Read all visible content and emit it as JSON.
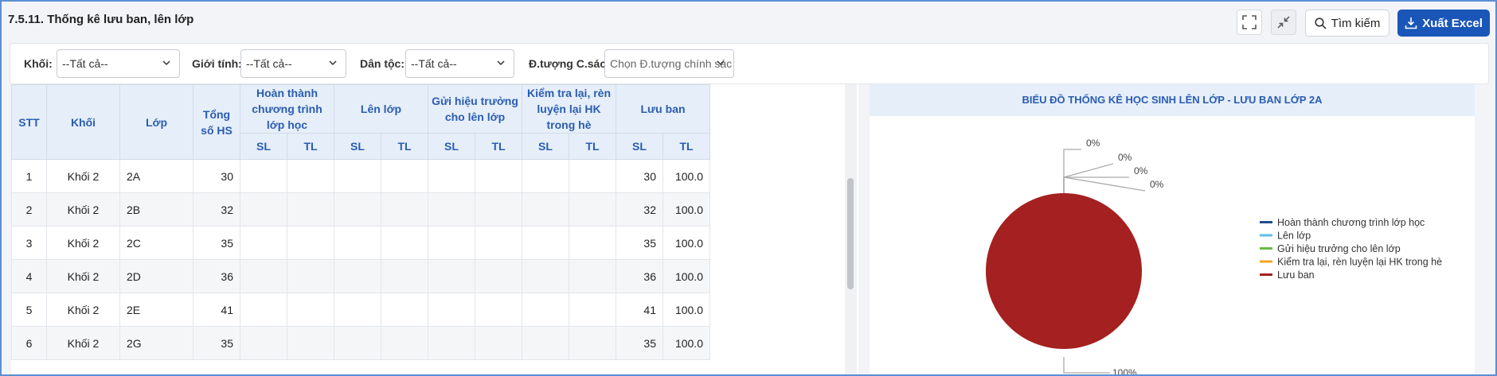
{
  "header": {
    "title": "7.5.11. Thống kê lưu ban, lên lớp",
    "search_label": "Tìm kiếm",
    "excel_label": "Xuất Excel"
  },
  "filters": {
    "khoi_label": "Khối:",
    "khoi_value": "--Tất cả--",
    "gioitinh_label": "Giới tính:",
    "gioitinh_value": "--Tất cả--",
    "dantoc_label": "Dân tộc:",
    "dantoc_value": "--Tất cả--",
    "doituong_label": "Đ.tượng C.sách:",
    "doituong_placeholder": "Chọn Đ.tượng chính sác"
  },
  "table": {
    "headers": {
      "stt": "STT",
      "khoi": "Khối",
      "lop": "Lớp",
      "tongso": "Tổng số HS",
      "hoanthanh": "Hoàn thành chương trình lớp học",
      "lenlop": "Lên lớp",
      "guihieutruong": "Gửi hiệu trưởng cho lên lớp",
      "kiemtra": "Kiểm tra lại, rèn luyện lại HK trong hè",
      "luuban": "Lưu ban",
      "sl": "SL",
      "tl": "TL"
    },
    "rows": [
      {
        "stt": "1",
        "khoi": "Khối 2",
        "lop": "2A",
        "tong": "30",
        "lb_sl": "30",
        "lb_tl": "100.0"
      },
      {
        "stt": "2",
        "khoi": "Khối 2",
        "lop": "2B",
        "tong": "32",
        "lb_sl": "32",
        "lb_tl": "100.0"
      },
      {
        "stt": "3",
        "khoi": "Khối 2",
        "lop": "2C",
        "tong": "35",
        "lb_sl": "35",
        "lb_tl": "100.0"
      },
      {
        "stt": "4",
        "khoi": "Khối 2",
        "lop": "2D",
        "tong": "36",
        "lb_sl": "36",
        "lb_tl": "100.0"
      },
      {
        "stt": "5",
        "khoi": "Khối 2",
        "lop": "2E",
        "tong": "41",
        "lb_sl": "41",
        "lb_tl": "100.0"
      },
      {
        "stt": "6",
        "khoi": "Khối 2",
        "lop": "2G",
        "tong": "35",
        "lb_sl": "35",
        "lb_tl": "100.0"
      }
    ]
  },
  "chart_data": {
    "type": "pie",
    "title": "BIỂU ĐỒ THỐNG KÊ HỌC SINH LÊN LỚP - LƯU BAN LỚP 2A",
    "categories": [
      "Hoàn thành chương trình lớp học",
      "Lên lớp",
      "Gửi hiệu trưởng cho lên lớp",
      "Kiểm tra lại, rèn luyện lại HK trong hè",
      "Lưu ban"
    ],
    "values": [
      0,
      0,
      0,
      0,
      100
    ],
    "data_labels": [
      "0%",
      "0%",
      "0%",
      "0%",
      "100%"
    ],
    "colors": [
      "#1f4e8c",
      "#5bc0eb",
      "#66bb44",
      "#f5a623",
      "#a52020"
    ],
    "legend_position": "right"
  }
}
